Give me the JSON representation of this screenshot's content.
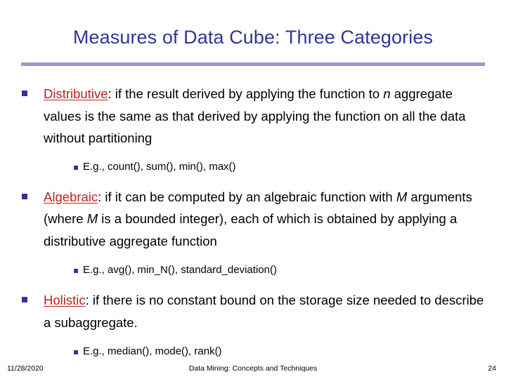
{
  "slide": {
    "title": "Measures of Data Cube: Three Categories",
    "accent_rule_color": "#9999cc",
    "title_color": "#333399",
    "term_color": "#bf1f1f",
    "bullet_color": "#333399",
    "background_color": "#ffffff"
  },
  "bullets": [
    {
      "term": "Distributive",
      "after_term": ": if the result derived by applying the function to ",
      "italic_1": "n",
      "tail": " aggregate values is the same as that derived by applying the function on all the data without partitioning",
      "sub": "E.g., count(), sum(), min(), max()"
    },
    {
      "term": "Algebraic",
      "after_term": ": if it can be computed by an algebraic function with ",
      "italic_1": "M",
      "mid": " arguments (where ",
      "italic_2": "M",
      "tail": " is a bounded integer), each of which is obtained by applying a distributive aggregate function",
      "sub": "E.g.,  avg(), min_N(), standard_deviation()"
    },
    {
      "term": "Holistic",
      "after_term": ": if there is no constant bound on the storage size needed to describe a subaggregate.",
      "sub": "E.g., median(), mode(), rank()"
    }
  ],
  "footer": {
    "date": "11/28/2020",
    "center": "Data Mining: Concepts and Techniques",
    "page_number": "24"
  }
}
